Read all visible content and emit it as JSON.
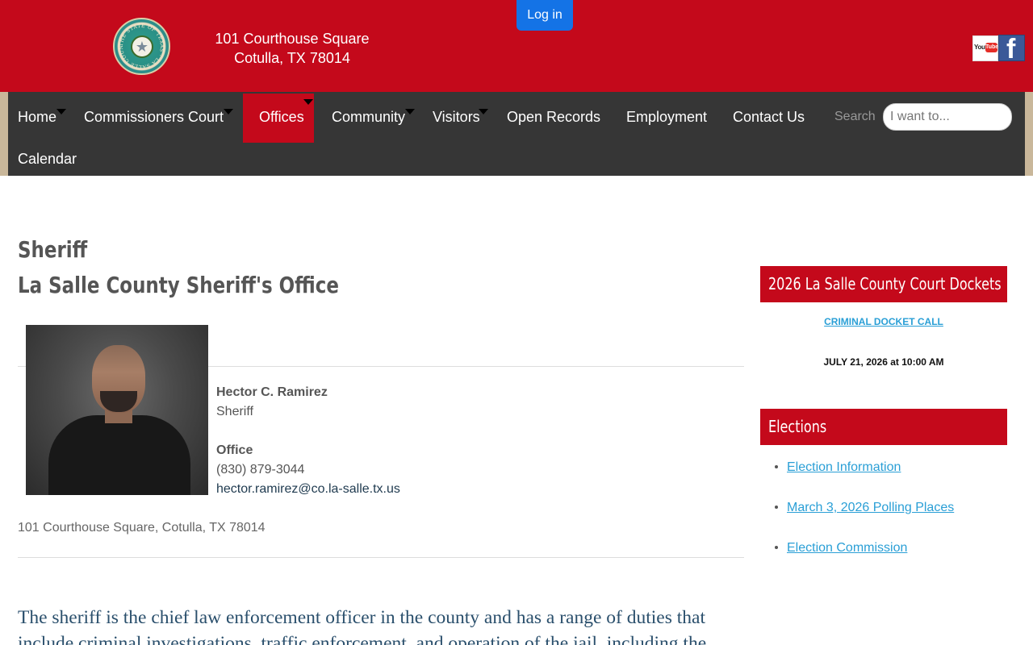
{
  "header": {
    "address_line1": "101 Courthouse Square",
    "address_line2": "Cotulla, TX 78014",
    "login_label": "Log in",
    "seal_text": "THE STATE OF TEXAS · LA SALLE COUNTY",
    "youtube_label": "YouTube",
    "youtube_you": "You",
    "youtube_tube": "Tube",
    "facebook_glyph": "f"
  },
  "nav": {
    "items": [
      {
        "label": "Home",
        "has_dropdown": true
      },
      {
        "label": "Commissioners Court",
        "has_dropdown": true
      },
      {
        "label": "Offices",
        "has_dropdown": true,
        "active": true
      },
      {
        "label": "Community",
        "has_dropdown": true
      },
      {
        "label": "Visitors",
        "has_dropdown": true
      },
      {
        "label": "Open Records",
        "has_dropdown": false
      },
      {
        "label": "Employment",
        "has_dropdown": false
      },
      {
        "label": "Contact Us",
        "has_dropdown": false
      },
      {
        "label": "Calendar",
        "has_dropdown": false
      }
    ],
    "search_label": "Search",
    "search_placeholder": "I want to..."
  },
  "main": {
    "title": "Sheriff",
    "subtitle": "La Salle County Sheriff's Office",
    "official": {
      "name": "Hector C. Ramirez",
      "role": "Sheriff",
      "office_heading": "Office",
      "phone": "(830) 879-3044",
      "email": "hector.ramirez@co.la-salle.tx.us"
    },
    "address": "101 Courthouse Square, Cotulla, TX 78014",
    "body_text": "The sheriff is the chief law enforcement officer in the county and has a range of duties that include criminal investigations, traffic enforcement, and operation of the jail, including the"
  },
  "sidebar": {
    "dockets": {
      "heading": "2026 La Salle County Court Dockets",
      "link": "CRIMINAL DOCKET CALL",
      "date": "JULY 21, 2026 at 10:00 AM"
    },
    "elections": {
      "heading": "Elections",
      "links": [
        "Election Information",
        "March 3, 2026 Polling Places",
        "Election Commission"
      ]
    }
  },
  "colors": {
    "brand_red": "#c4091b",
    "nav_dark": "#363636",
    "login_blue": "#1473e6",
    "link_blue": "#2a9fd6"
  }
}
